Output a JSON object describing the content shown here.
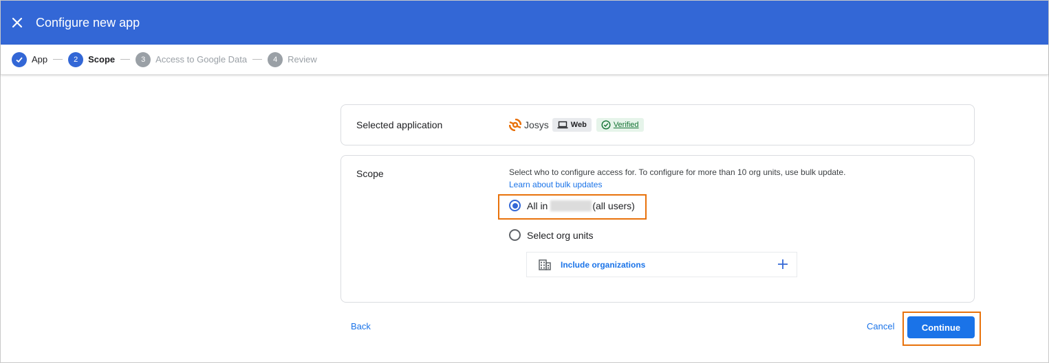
{
  "header": {
    "title": "Configure new app",
    "bg_color": "#3367d6"
  },
  "stepper": {
    "steps": [
      {
        "number": "",
        "label": "App",
        "state": "done"
      },
      {
        "number": "2",
        "label": "Scope",
        "state": "active"
      },
      {
        "number": "3",
        "label": "Access to Google Data",
        "state": "todo"
      },
      {
        "number": "4",
        "label": "Review",
        "state": "todo"
      }
    ]
  },
  "selected_app": {
    "label": "Selected application",
    "app_name": "Josys",
    "platform_chip": "Web",
    "verified_chip": "Verified"
  },
  "scope": {
    "label": "Scope",
    "description": "Select who to configure access for. To configure for more than 10 org units, use bulk update.",
    "bulk_link": "Learn about bulk updates",
    "option_all_prefix": "All in",
    "option_all_suffix": "(all users)",
    "option_all_selected": true,
    "option_org_units": "Select org units",
    "include_orgs": "Include organizations"
  },
  "footer": {
    "back": "Back",
    "cancel": "Cancel",
    "continue": "Continue"
  },
  "colors": {
    "accent": "#1a73e8",
    "highlight": "#e8710a"
  }
}
